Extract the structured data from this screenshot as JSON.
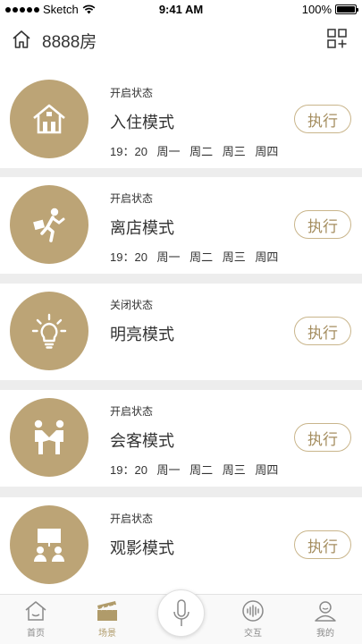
{
  "status_bar": {
    "carrier": "Sketch",
    "time": "9:41 AM",
    "battery": "100%"
  },
  "header": {
    "title": "8888房"
  },
  "colors": {
    "accent": "#bca476",
    "button_text": "#a58e60",
    "background": "#ededed"
  },
  "scenes": [
    {
      "icon": "house-icon",
      "state": "开启状态",
      "name": "入住模式",
      "schedule": "19：20 周一 周二 周三 周四",
      "action": "执行"
    },
    {
      "icon": "running-person-icon",
      "state": "开启状态",
      "name": "离店模式",
      "schedule": "19：20 周一 周二 周三 周四",
      "action": "执行"
    },
    {
      "icon": "lightbulb-icon",
      "state": "关闭状态",
      "name": "明亮模式",
      "schedule": "",
      "action": "执行"
    },
    {
      "icon": "people-greeting-icon",
      "state": "开启状态",
      "name": "会客模式",
      "schedule": "19：20 周一 周二 周三 周四",
      "action": "执行"
    },
    {
      "icon": "projector-screen-icon",
      "state": "开启状态",
      "name": "观影模式",
      "schedule": "",
      "action": "执行"
    }
  ],
  "tabbar": {
    "tabs": [
      {
        "label": "首页",
        "icon": "home-icon",
        "active": false
      },
      {
        "label": "场景",
        "icon": "scene-clapper-icon",
        "active": true
      },
      {
        "label": "交互",
        "icon": "voice-wave-icon",
        "active": false
      },
      {
        "label": "我的",
        "icon": "user-icon",
        "active": false
      }
    ],
    "center_icon": "microphone-icon"
  }
}
